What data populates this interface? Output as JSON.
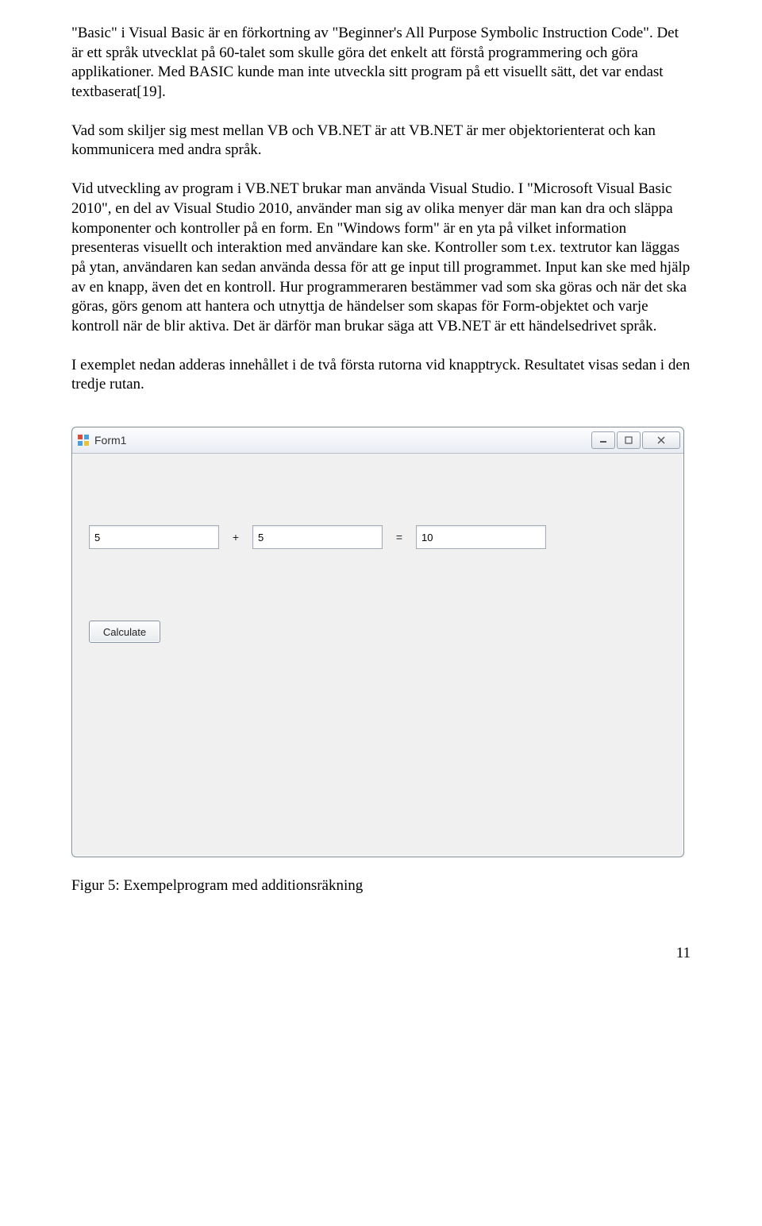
{
  "paragraphs": {
    "p1": "\"Basic\" i Visual Basic är en förkortning av \"Beginner's All Purpose Symbolic Instruction Code\". Det är ett språk utvecklat på 60-talet som skulle göra det enkelt att förstå programmering och göra applikationer. Med BASIC kunde man inte utveckla sitt program på ett visuellt sätt, det var endast textbaserat[19].",
    "p2": "Vad som skiljer sig mest mellan VB och VB.NET är att VB.NET är mer objektorienterat och kan kommunicera med andra språk.",
    "p3": "Vid utveckling av program i VB.NET brukar man använda Visual Studio. I \"Microsoft Visual Basic 2010\", en del av Visual Studio 2010, använder man sig av olika menyer där man kan dra och släppa komponenter och kontroller på en form. En \"Windows form\" är en yta på vilket information presenteras visuellt och interaktion med användare kan ske. Kontroller som t.ex. textrutor kan läggas på ytan, användaren kan sedan använda dessa för att ge input till programmet. Input kan ske med hjälp av en knapp, även det en kontroll. Hur programmeraren bestämmer vad som ska göras och när det ska göras, görs genom att hantera och utnyttja de händelser som skapas för Form-objektet och varje kontroll när de blir aktiva. Det är därför man brukar säga att VB.NET är ett händelsedrivet språk.",
    "p4": "I exemplet nedan adderas innehållet i de två första rutorna vid knapptryck. Resultatet visas sedan i den tredje rutan."
  },
  "window": {
    "title": "Form1",
    "input1": "5",
    "operator": "+",
    "input2": "5",
    "equals": "=",
    "result": "10",
    "button": "Calculate"
  },
  "figure_caption": "Figur 5: Exempelprogram med additionsräkning",
  "page_number": "11"
}
